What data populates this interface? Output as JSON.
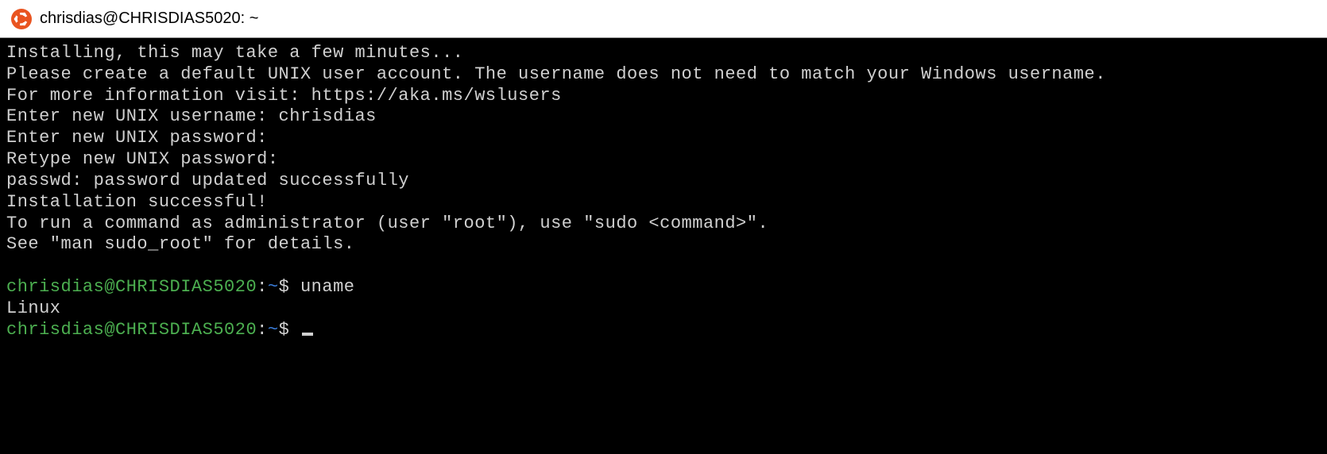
{
  "window": {
    "title": "chrisdias@CHRISDIAS5020: ~"
  },
  "terminal": {
    "lines": [
      "Installing, this may take a few minutes...",
      "Please create a default UNIX user account. The username does not need to match your Windows username.",
      "For more information visit: https://aka.ms/wslusers",
      "Enter new UNIX username: chrisdias",
      "Enter new UNIX password:",
      "Retype new UNIX password:",
      "passwd: password updated successfully",
      "Installation successful!",
      "To run a command as administrator (user \"root\"), use \"sudo <command>\".",
      "See \"man sudo_root\" for details."
    ],
    "prompt1": {
      "user_host": "chrisdias@CHRISDIAS5020",
      "colon": ":",
      "path": "~",
      "dollar": "$",
      "command": " uname"
    },
    "output1": "Linux",
    "prompt2": {
      "user_host": "chrisdias@CHRISDIAS5020",
      "colon": ":",
      "path": "~",
      "dollar": "$",
      "command": " "
    }
  }
}
